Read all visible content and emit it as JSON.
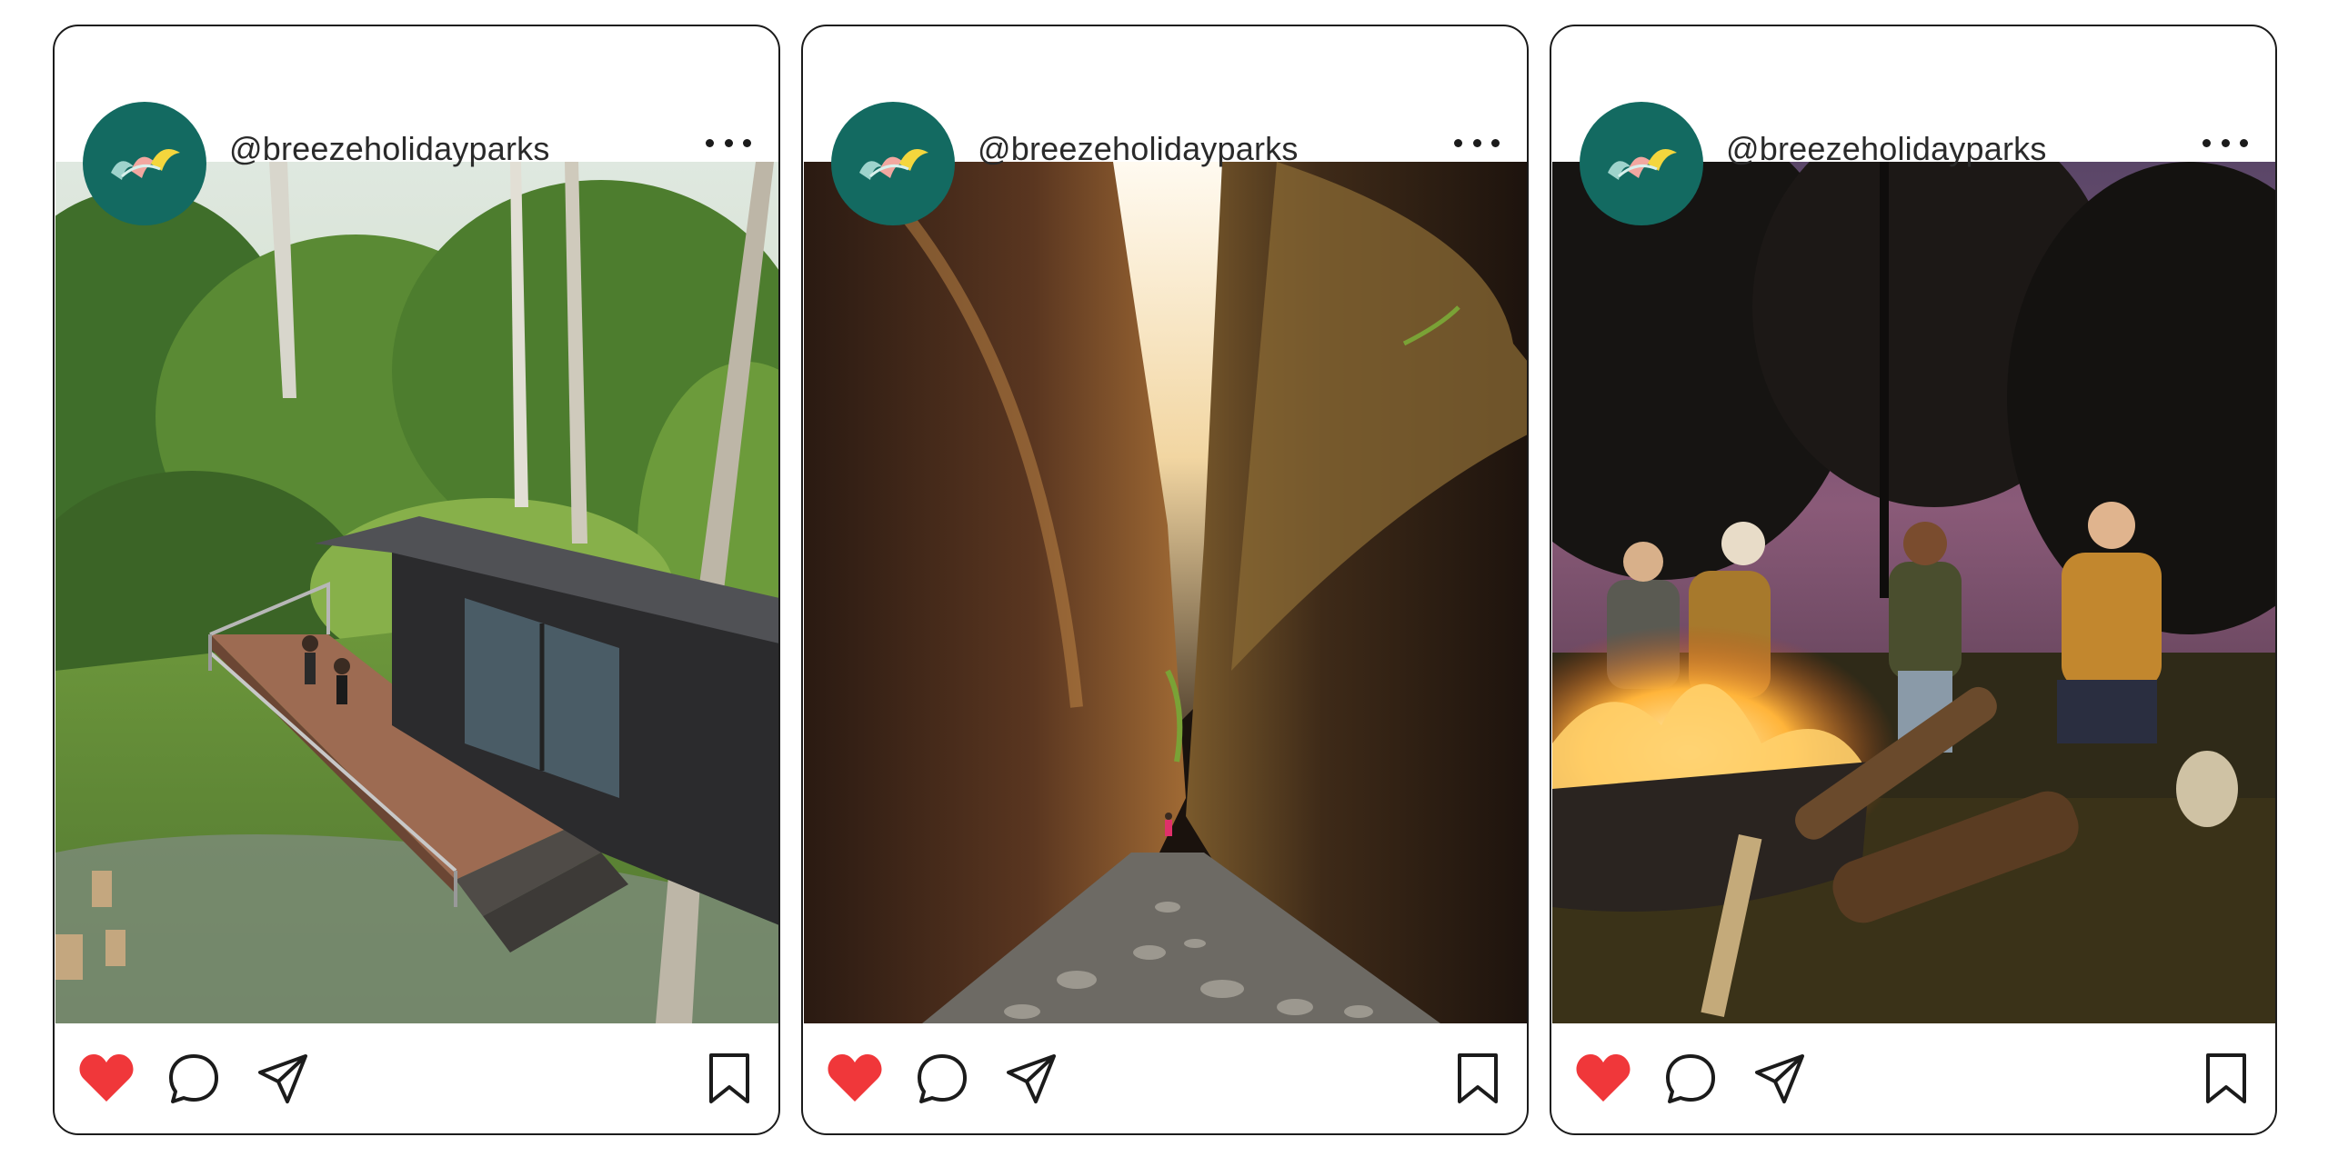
{
  "brand": {
    "accent": "#136a61",
    "like_color": "#f0373a"
  },
  "posts": [
    {
      "handle": "@breezeholidayparks",
      "avatar_icon": "breeze-logo-icon",
      "photo_subject": "cabin",
      "liked": true
    },
    {
      "handle": "@breezeholidayparks",
      "avatar_icon": "breeze-logo-icon",
      "photo_subject": "gorge",
      "liked": true
    },
    {
      "handle": "@breezeholidayparks",
      "avatar_icon": "breeze-logo-icon",
      "photo_subject": "campfire",
      "liked": true
    }
  ],
  "icons": {
    "more": "more-horizontal-icon",
    "like": "heart-icon",
    "comment": "comment-bubble-icon",
    "share": "paper-plane-icon",
    "save": "bookmark-icon"
  }
}
